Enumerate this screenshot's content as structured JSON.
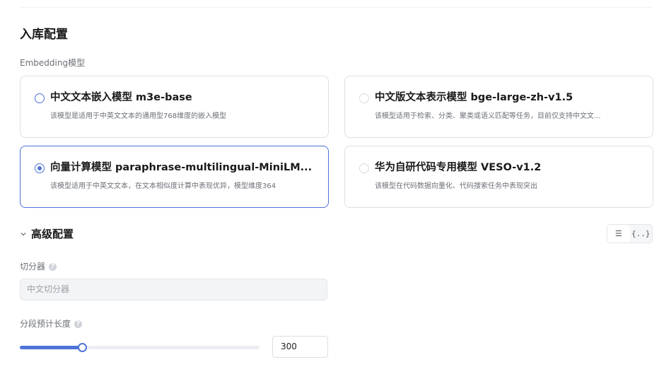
{
  "section": {
    "title": "入库配置"
  },
  "embedding": {
    "label": "Embedding模型",
    "selected_index": 2,
    "models": [
      {
        "name": "中文文本嵌入模型 m3e-base",
        "description": "该模型是适用于中英文文本的通用型768维度的嵌入模型"
      },
      {
        "name": "中文版文本表示模型 bge-large-zh-v1.5",
        "description": "该模型适用于检索、分类、聚类或语义匹配等任务，目前仅支持中文文..."
      },
      {
        "name": "向量计算模型 paraphrase-multilingual-MiniLM...",
        "description": "该模型适用于中英文文本，在文本相似度计算中表现优异，模型维度364"
      },
      {
        "name": "华为自研代码专用模型 VESO-v1.2",
        "description": "该模型在代码数据向量化、代码搜索任务中表现突出"
      }
    ]
  },
  "advanced": {
    "title": "高级配置",
    "expanded": true,
    "chevron_icon": "chevron-down-icon",
    "view_icons": [
      "list-view-icon",
      "code-view-icon"
    ],
    "view_glyphs": [
      "☰",
      "{..}"
    ]
  },
  "splitter": {
    "label": "切分器",
    "help_glyph": "?",
    "value": "中文切分器"
  },
  "segment_length": {
    "label": "分段预计长度",
    "help_glyph": "?",
    "value": "300",
    "slider_fraction": 0.26
  },
  "colors": {
    "accent": "#4d73d9",
    "border": "#dcdfe5",
    "muted_text": "#6b6f76",
    "disabled_bg": "#f3f4f6"
  }
}
